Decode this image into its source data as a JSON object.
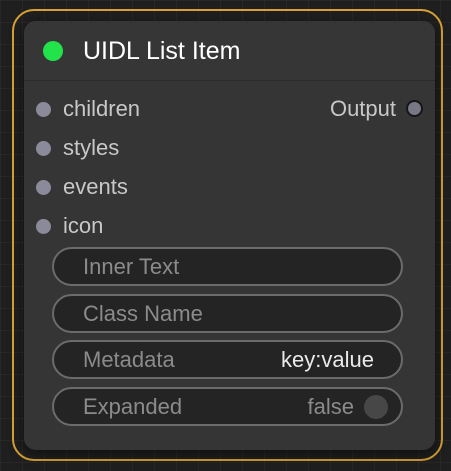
{
  "node": {
    "title": "UIDL List Item",
    "status_color": "#22e34a",
    "outline_color": "#d9a233",
    "inputs": [
      "children",
      "styles",
      "events",
      "icon"
    ],
    "output_label": "Output"
  },
  "widgets": {
    "inner_text": {
      "label": "Inner Text",
      "value": ""
    },
    "class_name": {
      "label": "Class Name",
      "value": ""
    },
    "metadata": {
      "label": "Metadata",
      "value": "key:value"
    },
    "expanded": {
      "label": "Expanded",
      "value": "false"
    }
  }
}
